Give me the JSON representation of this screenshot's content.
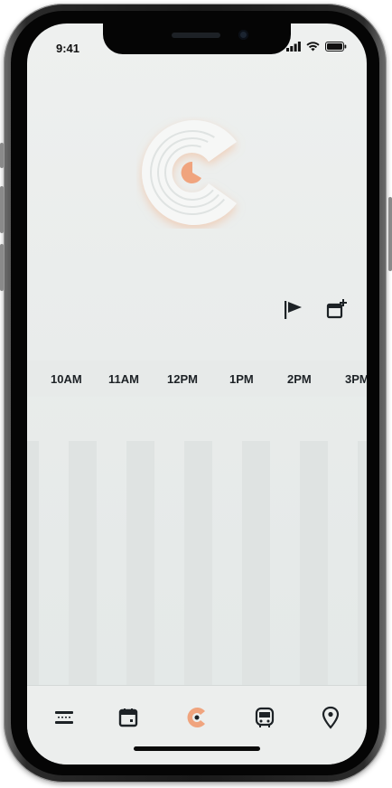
{
  "status_bar": {
    "time": "9:41"
  },
  "timeline": {
    "hours": [
      "10AM",
      "11AM",
      "12PM",
      "1PM",
      "2PM",
      "3PM"
    ]
  },
  "actions": {
    "flag_icon": "flag-icon",
    "add_event_icon": "calendar-plus-icon"
  },
  "tab_bar": {
    "tabs": [
      {
        "icon": "list-icon"
      },
      {
        "icon": "calendar-icon"
      },
      {
        "icon": "logo-c-icon",
        "active": true
      },
      {
        "icon": "transit-icon"
      },
      {
        "icon": "location-pin-icon"
      }
    ]
  },
  "colors": {
    "accent": "#f0a47e",
    "dark": "#1d2226",
    "background": "#eceeed"
  }
}
